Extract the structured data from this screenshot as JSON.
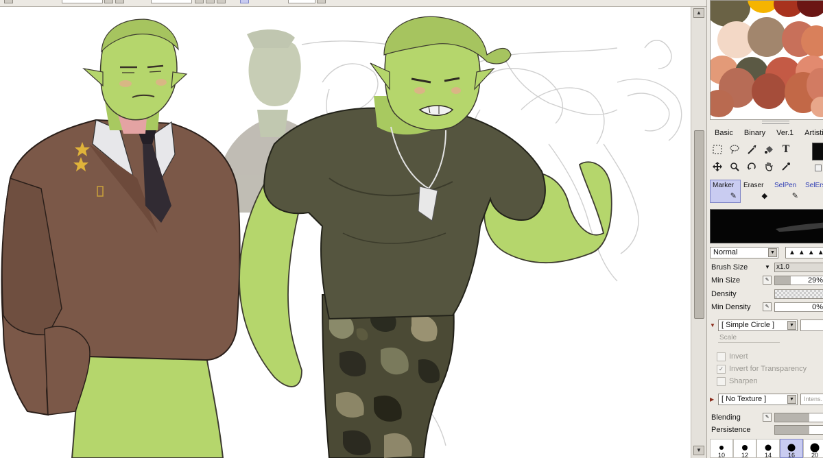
{
  "colors": {
    "accent": "#c9ccf1",
    "orc_skin": "#b5d66c",
    "jacket": "#7b5848",
    "tshirt": "#55553f",
    "camo_base": "#4b4a35"
  },
  "palette_colors": [
    "#6a6245",
    "#f5b400",
    "#a8321e",
    "#6b1614",
    "#f3d8c6",
    "#a2866d",
    "#c8705a",
    "#d9805b",
    "#e39a78",
    "#5b5944",
    "#c45a45",
    "#e28a6f",
    "#b76c56",
    "#a54d3a",
    "#c26847",
    "#d27b62",
    "#b96a50",
    "#e8a78a"
  ],
  "tabs": [
    {
      "label": "Basic",
      "active": true
    },
    {
      "label": "Binary",
      "active": false
    },
    {
      "label": "Ver.1",
      "active": false
    },
    {
      "label": "Artistic",
      "active": false
    }
  ],
  "tools": [
    "rect-select-icon",
    "lasso-icon",
    "magic-wand-icon",
    "fill-bucket-icon",
    "text-icon",
    "move-icon",
    "zoom-icon",
    "rotate-icon",
    "hand-icon",
    "eyedropper-icon"
  ],
  "text_tool_label": "T",
  "brushes": [
    {
      "label": "Marker",
      "icon": "marker-icon",
      "active": true
    },
    {
      "label": "Eraser",
      "icon": "eraser-icon",
      "active": false
    },
    {
      "label": "SelPen",
      "icon": "selpen-icon",
      "active": false
    },
    {
      "label": "SelErs",
      "icon": "selers-icon",
      "active": false
    }
  ],
  "blend_mode": "Normal",
  "params": {
    "brush_size_label": "Brush Size",
    "brush_size_mult": "x1.0",
    "min_size_label": "Min Size",
    "min_size_value": "29%",
    "density_label": "Density",
    "min_density_label": "Min Density",
    "min_density_value": "0%"
  },
  "shape_select": "[ Simple Circle ]",
  "scale_label": "Scale",
  "checkboxes": [
    {
      "label": "Invert",
      "checked": false
    },
    {
      "label": "Invert for Transparency",
      "checked": true
    },
    {
      "label": "Sharpen",
      "checked": false
    }
  ],
  "texture_select": "[ No Texture ]",
  "texture_intensity": "Intens.",
  "blending_label": "Blending",
  "persistence_label": "Persistence",
  "size_dots": [
    {
      "label": "10",
      "active": false
    },
    {
      "label": "12",
      "active": false
    },
    {
      "label": "14",
      "active": false
    },
    {
      "label": "16",
      "active": true
    },
    {
      "label": "20",
      "active": false
    }
  ]
}
